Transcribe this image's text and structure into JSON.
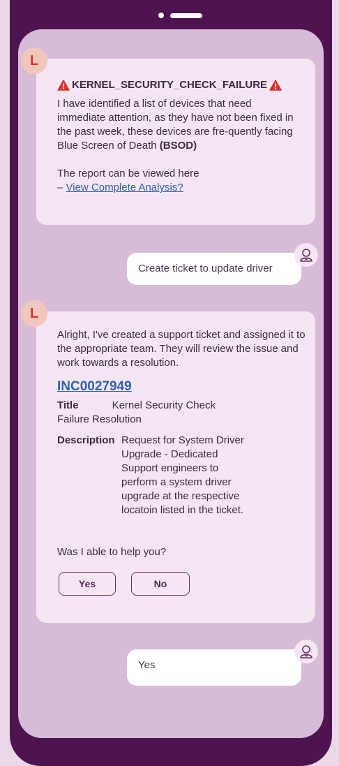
{
  "alert": {
    "title": "KERNEL_SECURITY_CHECK_FAILURE",
    "body_pre": "I have identified a list of devices that need immediate attention, as they have not been fixed in the past week, these devices are fre-quently facing Blue Screen of Death ",
    "body_bold": "(BSOD)",
    "report_line": "The report can be viewed here",
    "report_prefix": "– ",
    "report_link": "View Complete Analysis?"
  },
  "bot_initial": "L",
  "user_message_1": "Create ticket to update driver",
  "reply": {
    "intro": "Alright, I've created a support ticket and assigned it to the appropriate team. They will review the issue and work towards a resolution.",
    "ticket_id": "INC0027949",
    "title_label": "Title",
    "title_value_1": "Kernel Security Check",
    "title_value_2": "Failure Resolution",
    "desc_label": "Description",
    "desc_value": "Request for System Driver Upgrade - Dedicated Support engineers to perform a system driver upgrade at the respective locatoin listed in the ticket.",
    "question": "Was I able to help you?",
    "yes": "Yes",
    "no": "No"
  },
  "user_message_2": "Yes",
  "colors": {
    "phone": "#4d1450",
    "screen": "#d8bcd7",
    "bot_bubble": "#f4e6f2",
    "user_bubble": "#ffffff",
    "alert_red": "#e0332f",
    "link": "#2e62b8",
    "avatar_bg": "#f2c7bb"
  }
}
